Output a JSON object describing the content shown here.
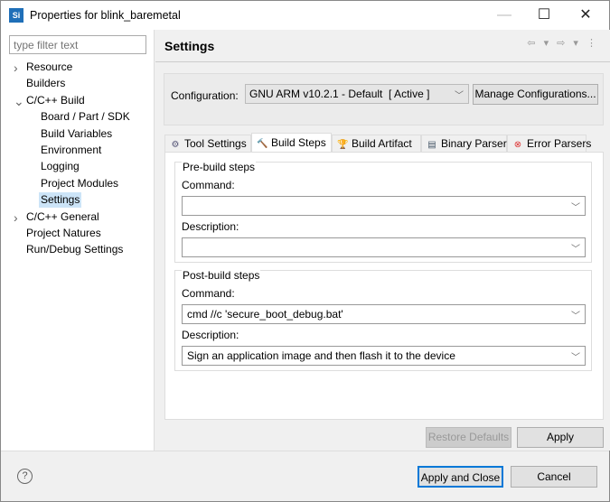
{
  "window": {
    "title": "Properties for blink_baremetal",
    "logo": "Si",
    "minimize": "—",
    "maximize": "☐",
    "close": "✕"
  },
  "sidebar": {
    "filter_placeholder": "type filter text",
    "items": [
      {
        "label": "Resource",
        "twisty": ">"
      },
      {
        "label": "Builders"
      },
      {
        "label": "C/C++ Build",
        "twisty": "v"
      },
      {
        "label": "Board / Part / SDK"
      },
      {
        "label": "Build Variables"
      },
      {
        "label": "Environment"
      },
      {
        "label": "Logging"
      },
      {
        "label": "Project Modules"
      },
      {
        "label": "Settings"
      },
      {
        "label": "C/C++ General",
        "twisty": ">"
      },
      {
        "label": "Project Natures"
      },
      {
        "label": "Run/Debug Settings"
      }
    ]
  },
  "header": {
    "title": "Settings",
    "nav": "⇦ ▾ ⇨ ▾ ⋮"
  },
  "config": {
    "label": "Configuration:",
    "value": "GNU ARM v10.2.1 - Default  [ Active ]",
    "manage": "Manage Configurations..."
  },
  "tabs": [
    {
      "label": "Tool Settings",
      "icon": "⚙"
    },
    {
      "label": "Build Steps",
      "icon": "🔨"
    },
    {
      "label": "Build Artifact",
      "icon": "🏆"
    },
    {
      "label": "Binary Parsers",
      "icon": "▤"
    },
    {
      "label": "Error Parsers",
      "icon": "⊗"
    }
  ],
  "pre": {
    "title": "Pre-build steps",
    "command_label": "Command:",
    "command": "",
    "description_label": "Description:",
    "description": ""
  },
  "post": {
    "title": "Post-build steps",
    "command_label": "Command:",
    "command": "cmd //c 'secure_boot_debug.bat'",
    "description_label": "Description:",
    "description": "Sign an application image and then flash it to the device"
  },
  "buttons": {
    "restore": "Restore Defaults",
    "apply": "Apply",
    "apply_close": "Apply and Close",
    "cancel": "Cancel",
    "help": "?"
  },
  "colors": {
    "accent": "#0078d7",
    "selection": "#cce4f7"
  }
}
